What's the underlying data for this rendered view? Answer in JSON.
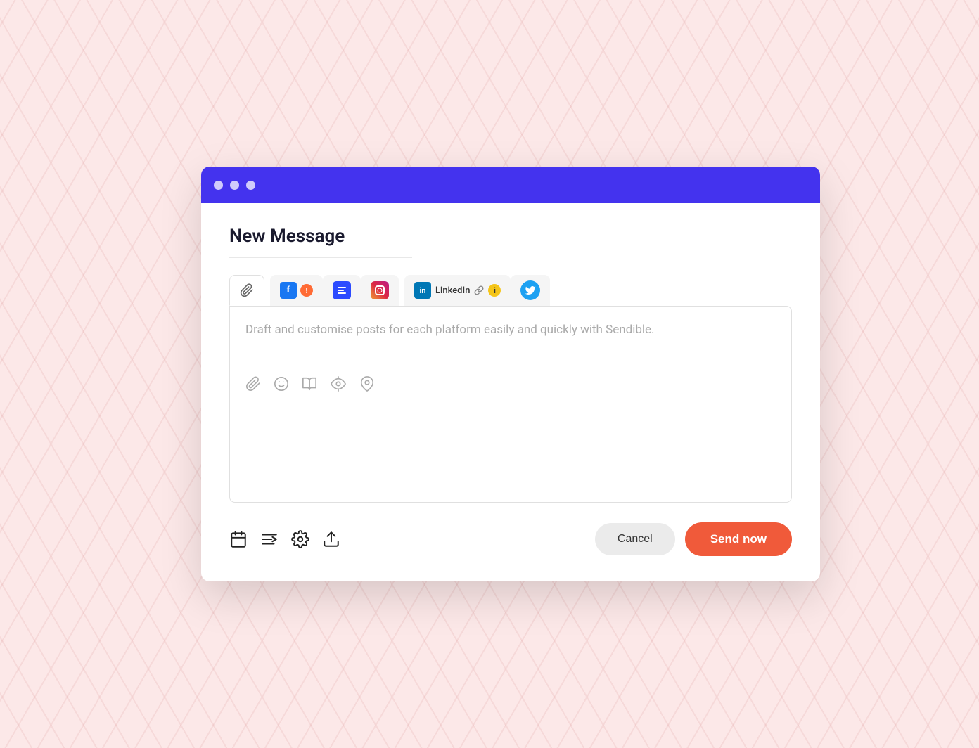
{
  "window": {
    "title": "New Message",
    "titlebar_dots": [
      "dot1",
      "dot2",
      "dot3"
    ]
  },
  "tabs": [
    {
      "id": "all",
      "type": "paperclip"
    },
    {
      "id": "facebook",
      "type": "facebook",
      "has_warning": true
    },
    {
      "id": "buffer",
      "type": "buffer"
    },
    {
      "id": "instagram",
      "type": "instagram"
    },
    {
      "id": "linkedin",
      "type": "linkedin",
      "label": "LinkedIn",
      "has_link": true,
      "has_info": true
    },
    {
      "id": "twitter",
      "type": "twitter"
    }
  ],
  "composer": {
    "placeholder": "Draft and customise posts for each platform easily and quickly with Sendible.",
    "toolbar_icons": [
      "attachment",
      "emoji",
      "media",
      "preview",
      "location"
    ]
  },
  "bottom_tools": [
    "schedule",
    "queue",
    "settings",
    "export"
  ],
  "buttons": {
    "cancel": "Cancel",
    "send": "Send now"
  },
  "colors": {
    "titlebar": "#4433ee",
    "send_btn": "#f05a3a",
    "cancel_btn": "#ebebeb",
    "facebook": "#1877f2",
    "linkedin": "#0077b5",
    "twitter": "#1da1f2",
    "instagram_gradient_start": "#f09433",
    "instagram_gradient_end": "#bc1888"
  }
}
